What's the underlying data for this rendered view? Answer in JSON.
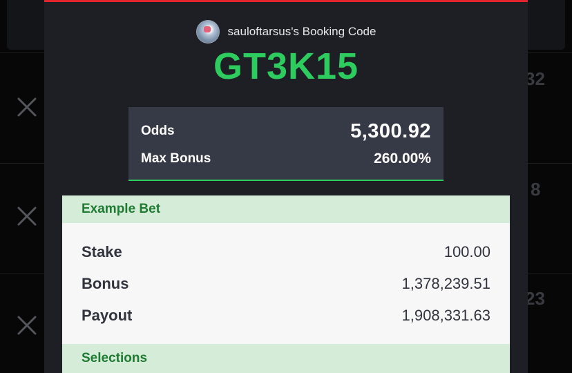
{
  "background": {
    "rows": [
      {
        "peek_text": "32"
      },
      {
        "peek_text": "8"
      },
      {
        "peek_text": "23"
      }
    ]
  },
  "modal": {
    "owner_text": "sauloftarsus's Booking Code",
    "booking_code": "GT3K15",
    "odds": {
      "odds_label": "Odds",
      "odds_value": "5,300.92",
      "bonus_label": "Max Bonus",
      "bonus_value": "260.00%"
    },
    "example_bet": {
      "title": "Example Bet",
      "rows": [
        {
          "label": "Stake",
          "value": "100.00"
        },
        {
          "label": "Bonus",
          "value": "1,378,239.51"
        },
        {
          "label": "Payout",
          "value": "1,908,331.63"
        }
      ]
    },
    "selections_title": "Selections"
  },
  "colors": {
    "accent_red": "#e4242c",
    "code_green": "#2ecc5f",
    "section_green_bg": "#d5ecd9",
    "section_green_text": "#1f7a32"
  }
}
